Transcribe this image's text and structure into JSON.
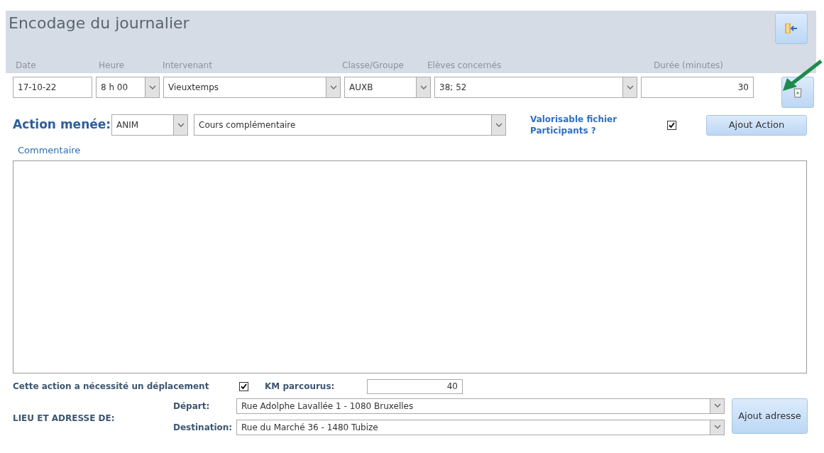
{
  "window": {
    "title": "Encodage du journalier"
  },
  "fields": [
    {
      "label": "Date",
      "value": "17-10-22",
      "kind": "text"
    },
    {
      "label": "Heure",
      "value": "8 h 00",
      "kind": "combo"
    },
    {
      "label": "Intervenant",
      "value": "Vieuxtemps",
      "kind": "combo"
    },
    {
      "label": "Classe/Groupe",
      "value": "AUXB",
      "kind": "combo"
    },
    {
      "label": "Elèves concernés",
      "value": "38; 52",
      "kind": "combo"
    },
    {
      "label": "Durée (minutes)",
      "value": "30",
      "kind": "number"
    }
  ],
  "action": {
    "label": "Action menée:",
    "code": "ANIM",
    "name": "Cours complémentaire",
    "valorisable_label": "Valorisable fichier Participants ?",
    "valorisable_checked": true,
    "button": "Ajout Action"
  },
  "comment": {
    "label": "Commentaire"
  },
  "travel": {
    "label": "Cette action a nécessité un déplacement",
    "checked": true,
    "km_label": "KM parcourus:",
    "km_value": "40",
    "place_label": "LIEU ET ADRESSE DE:",
    "depart_label": "Départ:",
    "depart_value": "Rue Adolphe Lavallée 1 - 1080 Bruxelles",
    "destination_label": "Destination:",
    "destination_value": "Rue du Marché 36 - 1480 Tubize",
    "button": "Ajout adresse"
  }
}
